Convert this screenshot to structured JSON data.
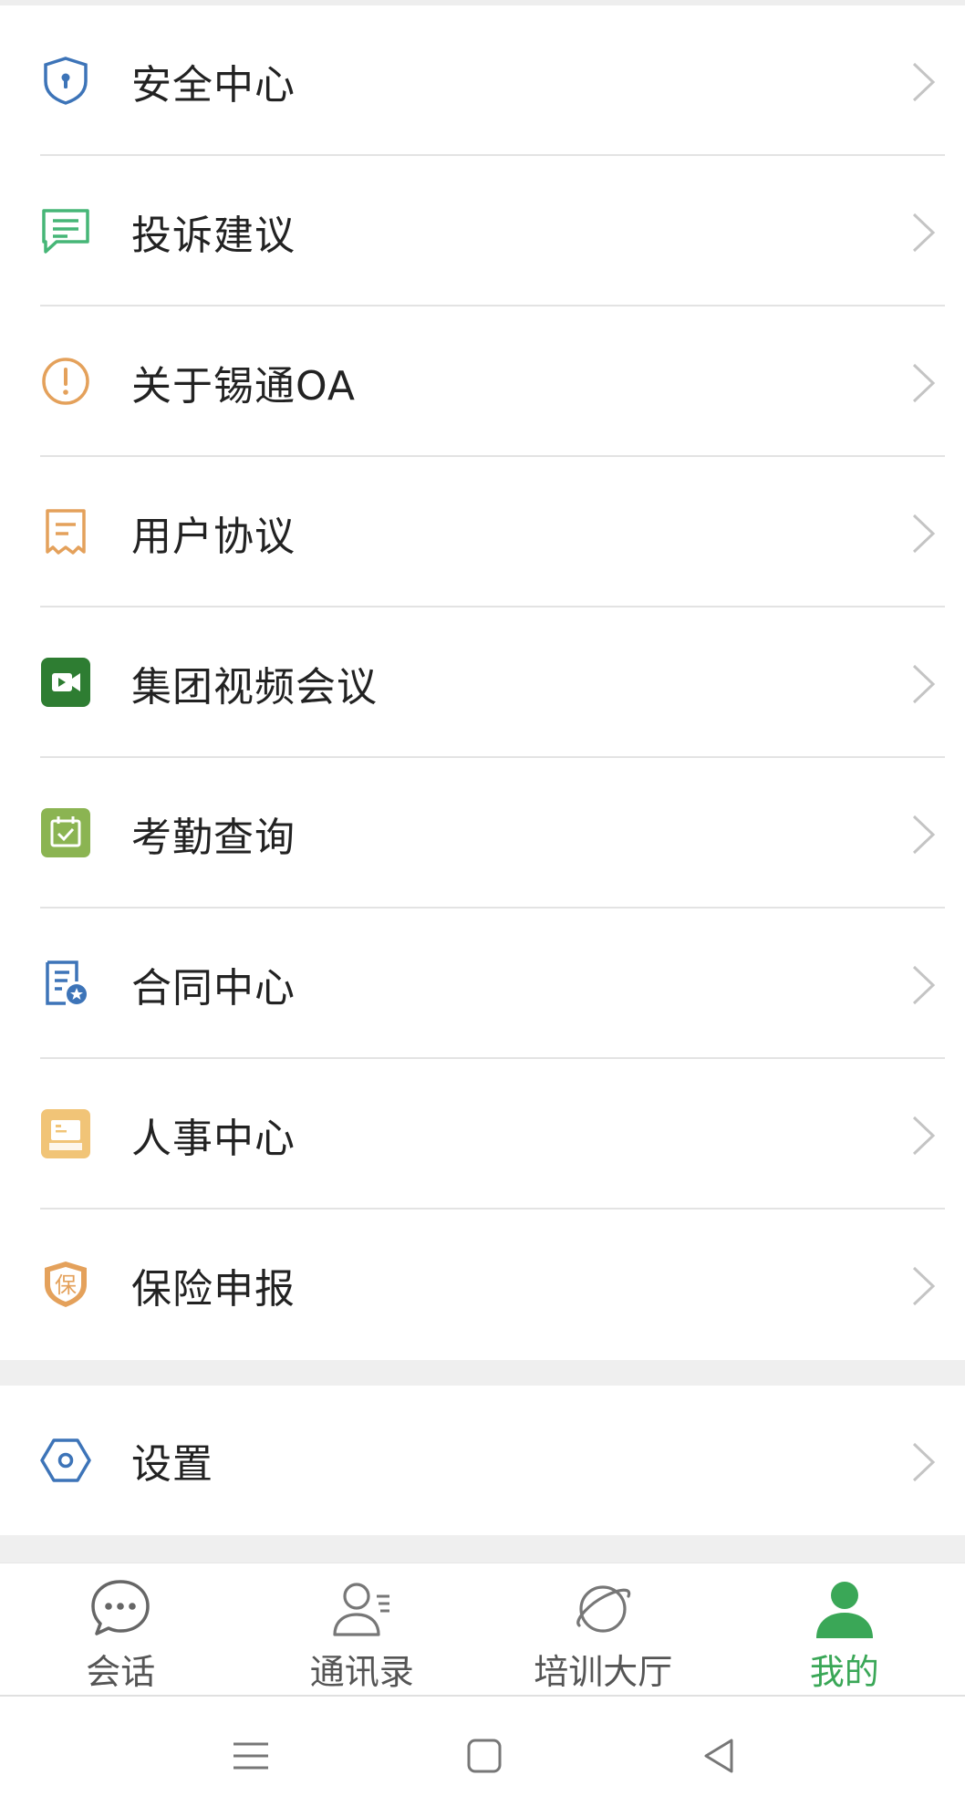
{
  "menu": {
    "items": [
      {
        "label": "安全中心",
        "icon": "shield-lock-icon"
      },
      {
        "label": "投诉建议",
        "icon": "message-lines-icon"
      },
      {
        "label": "关于锡通OA",
        "icon": "info-exclamation-icon"
      },
      {
        "label": "用户协议",
        "icon": "document-receipt-icon"
      },
      {
        "label": "集团视频会议",
        "icon": "video-camera-icon"
      },
      {
        "label": "考勤查询",
        "icon": "calendar-check-icon"
      },
      {
        "label": "合同中心",
        "icon": "contract-document-icon"
      },
      {
        "label": "人事中心",
        "icon": "personnel-icon"
      },
      {
        "label": "保险申报",
        "icon": "insurance-shield-icon"
      }
    ],
    "insurance_icon_char": "保"
  },
  "settings": {
    "label": "设置",
    "icon": "settings-hexagon-icon"
  },
  "tabbar": {
    "tabs": [
      {
        "label": "会话",
        "icon": "chat-bubble-icon",
        "active": false
      },
      {
        "label": "通讯录",
        "icon": "contacts-icon",
        "active": false
      },
      {
        "label": "培训大厅",
        "icon": "planet-icon",
        "active": false
      },
      {
        "label": "我的",
        "icon": "person-icon",
        "active": true
      }
    ]
  },
  "colors": {
    "accent_green": "#3aa757",
    "blue_icon": "#3d74b8",
    "orange_icon": "#e4a15b",
    "dark_green_icon": "#2e7d32",
    "olive_green_icon": "#8bb452",
    "yellow_icon": "#f1c477"
  }
}
